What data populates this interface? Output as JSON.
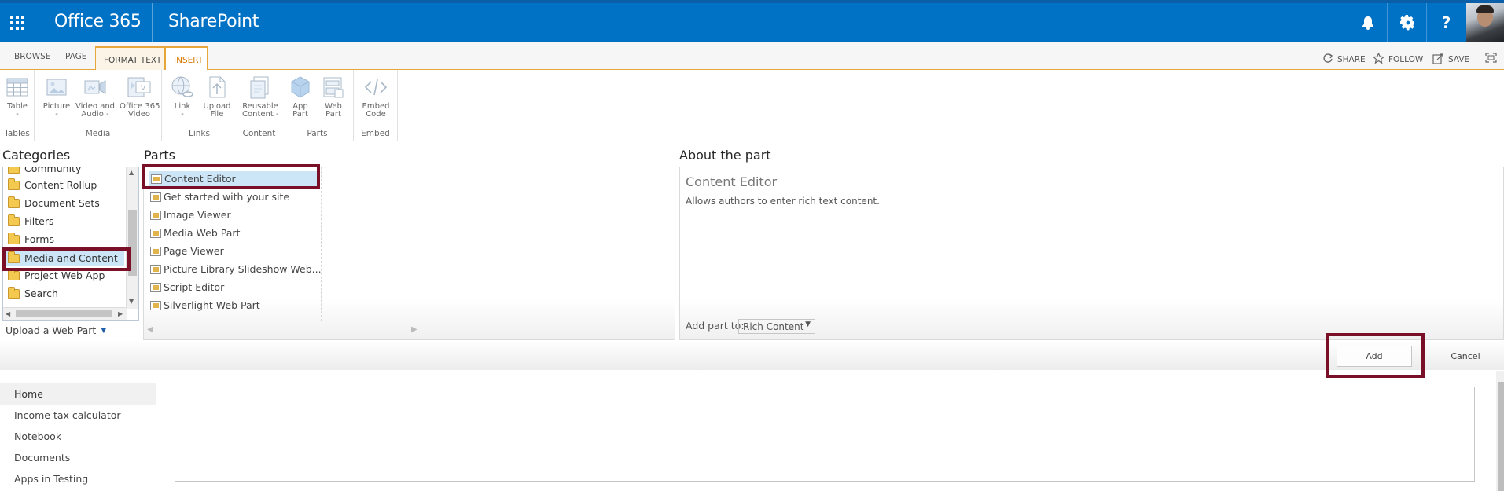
{
  "suite_bar": {
    "brand": "Office 365",
    "app": "SharePoint",
    "icons": [
      "app-launcher-icon",
      "bell-icon",
      "gear-icon",
      "help-icon"
    ],
    "help_glyph": "?",
    "avatar": "user-avatar"
  },
  "tabs": [
    {
      "label": "BROWSE"
    },
    {
      "label": "PAGE"
    },
    {
      "label": "FORMAT TEXT"
    },
    {
      "label": "INSERT",
      "selected": true
    }
  ],
  "page_actions": [
    {
      "label": "SHARE",
      "icon": "share-icon"
    },
    {
      "label": "FOLLOW",
      "icon": "star-icon"
    },
    {
      "label": "SAVE",
      "icon": "save-icon"
    },
    {
      "label": "",
      "icon": "focus-icon"
    }
  ],
  "ribbon": {
    "groups": [
      {
        "name": "Tables",
        "buttons": [
          {
            "label": "Table\n-",
            "icon": "table-icon"
          }
        ]
      },
      {
        "name": "Media",
        "buttons": [
          {
            "label": "Picture\n-",
            "icon": "picture-icon"
          },
          {
            "label": "Video and\nAudio -",
            "icon": "video-audio-icon"
          },
          {
            "label": "Office 365\nVideo",
            "icon": "office365-video-icon"
          }
        ]
      },
      {
        "name": "Links",
        "buttons": [
          {
            "label": "Link\n-",
            "icon": "link-icon"
          },
          {
            "label": "Upload\nFile",
            "icon": "upload-file-icon"
          }
        ]
      },
      {
        "name": "Content",
        "buttons": [
          {
            "label": "Reusable\nContent -",
            "icon": "reusable-content-icon"
          }
        ]
      },
      {
        "name": "Parts",
        "buttons": [
          {
            "label": "App\nPart",
            "icon": "app-part-icon"
          },
          {
            "label": "Web\nPart",
            "icon": "web-part-icon"
          }
        ]
      },
      {
        "name": "Embed",
        "buttons": [
          {
            "label": "Embed\nCode",
            "icon": "embed-code-icon"
          }
        ]
      }
    ]
  },
  "categories": {
    "title": "Categories",
    "items": [
      "Community",
      "Content Rollup",
      "Document Sets",
      "Filters",
      "Forms",
      "Media and Content",
      "Project Web App",
      "Search"
    ],
    "selected": "Media and Content",
    "upload_label": "Upload a Web Part"
  },
  "parts": {
    "title": "Parts",
    "items": [
      "Content Editor",
      "Get started with your site",
      "Image Viewer",
      "Media Web Part",
      "Page Viewer",
      "Picture Library Slideshow Web...",
      "Script Editor",
      "Silverlight Web Part"
    ],
    "selected": "Content Editor"
  },
  "about": {
    "title": "About the part",
    "part_name": "Content Editor",
    "description": "Allows authors to enter rich text content.",
    "add_to_label": "Add part to:",
    "add_to_value": "Rich Content"
  },
  "buttons": {
    "add": "Add",
    "cancel": "Cancel"
  },
  "left_nav": {
    "items": [
      "Home",
      "Income tax calculator",
      "Notebook",
      "Documents",
      "Apps in Testing"
    ],
    "selected": "Home"
  },
  "colors": {
    "suite_bar": "#0072c6",
    "accent": "#e6a63c",
    "highlight_border": "#7a1028"
  }
}
